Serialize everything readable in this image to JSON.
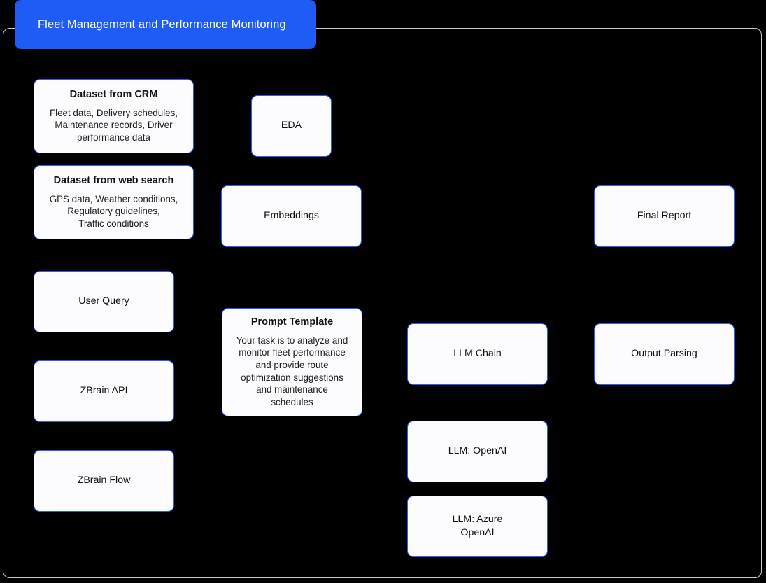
{
  "diagram": {
    "title": "Fleet Management and Performance Monitoring",
    "title_color": "#1f5bf5",
    "node_border_color": "#2a5cf5",
    "node_fill_color": "#fcfcfe",
    "frame_border_color": "#c9c9d1",
    "background_color": "#000000"
  },
  "nodes": {
    "dataset_crm": {
      "title": "Dataset from CRM",
      "body": "Fleet data, Delivery schedules,\nMaintenance records, Driver\nperformance data"
    },
    "dataset_web": {
      "title": "Dataset from web search",
      "body": "GPS data, Weather conditions,\nRegulatory guidelines,\nTraffic conditions"
    },
    "user_query": {
      "title": "User Query"
    },
    "zbrain_api": {
      "title": "ZBrain API"
    },
    "zbrain_flow": {
      "title": "ZBrain Flow"
    },
    "eda": {
      "title": "EDA"
    },
    "embeddings": {
      "title": "Embeddings"
    },
    "prompt_template": {
      "title": "Prompt Template",
      "body": "Your task is to analyze and\nmonitor fleet performance\nand provide route\noptimization suggestions\nand maintenance\nschedules"
    },
    "llm_chain": {
      "title": "LLM Chain"
    },
    "llm_openai": {
      "title": "LLM: OpenAI"
    },
    "llm_azure_openai": {
      "title": "LLM: Azure\nOpenAI"
    },
    "final_report": {
      "title": "Final Report"
    },
    "output_parsing": {
      "title": "Output Parsing"
    }
  }
}
